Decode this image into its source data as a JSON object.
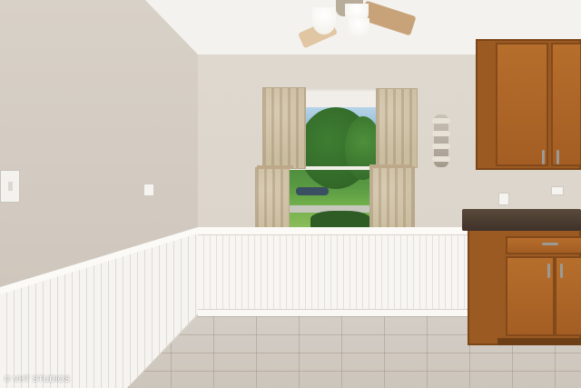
{
  "watermark": {
    "text": "© VHT STUDIOS"
  },
  "palette": {
    "wall": "#d8d1c7",
    "wainscot": "#f6f4f0",
    "cabinet": "#9a5a22",
    "countertop": "#4a3b2f",
    "floor_tile": "#d4cec6",
    "curtain": "#d8cbb3"
  },
  "icons": {
    "ceiling_fan": "ceiling-fan-icon",
    "light_switch": "light-switch-icon",
    "outlet": "outlet-icon",
    "sconce": "wall-sconce-icon"
  }
}
